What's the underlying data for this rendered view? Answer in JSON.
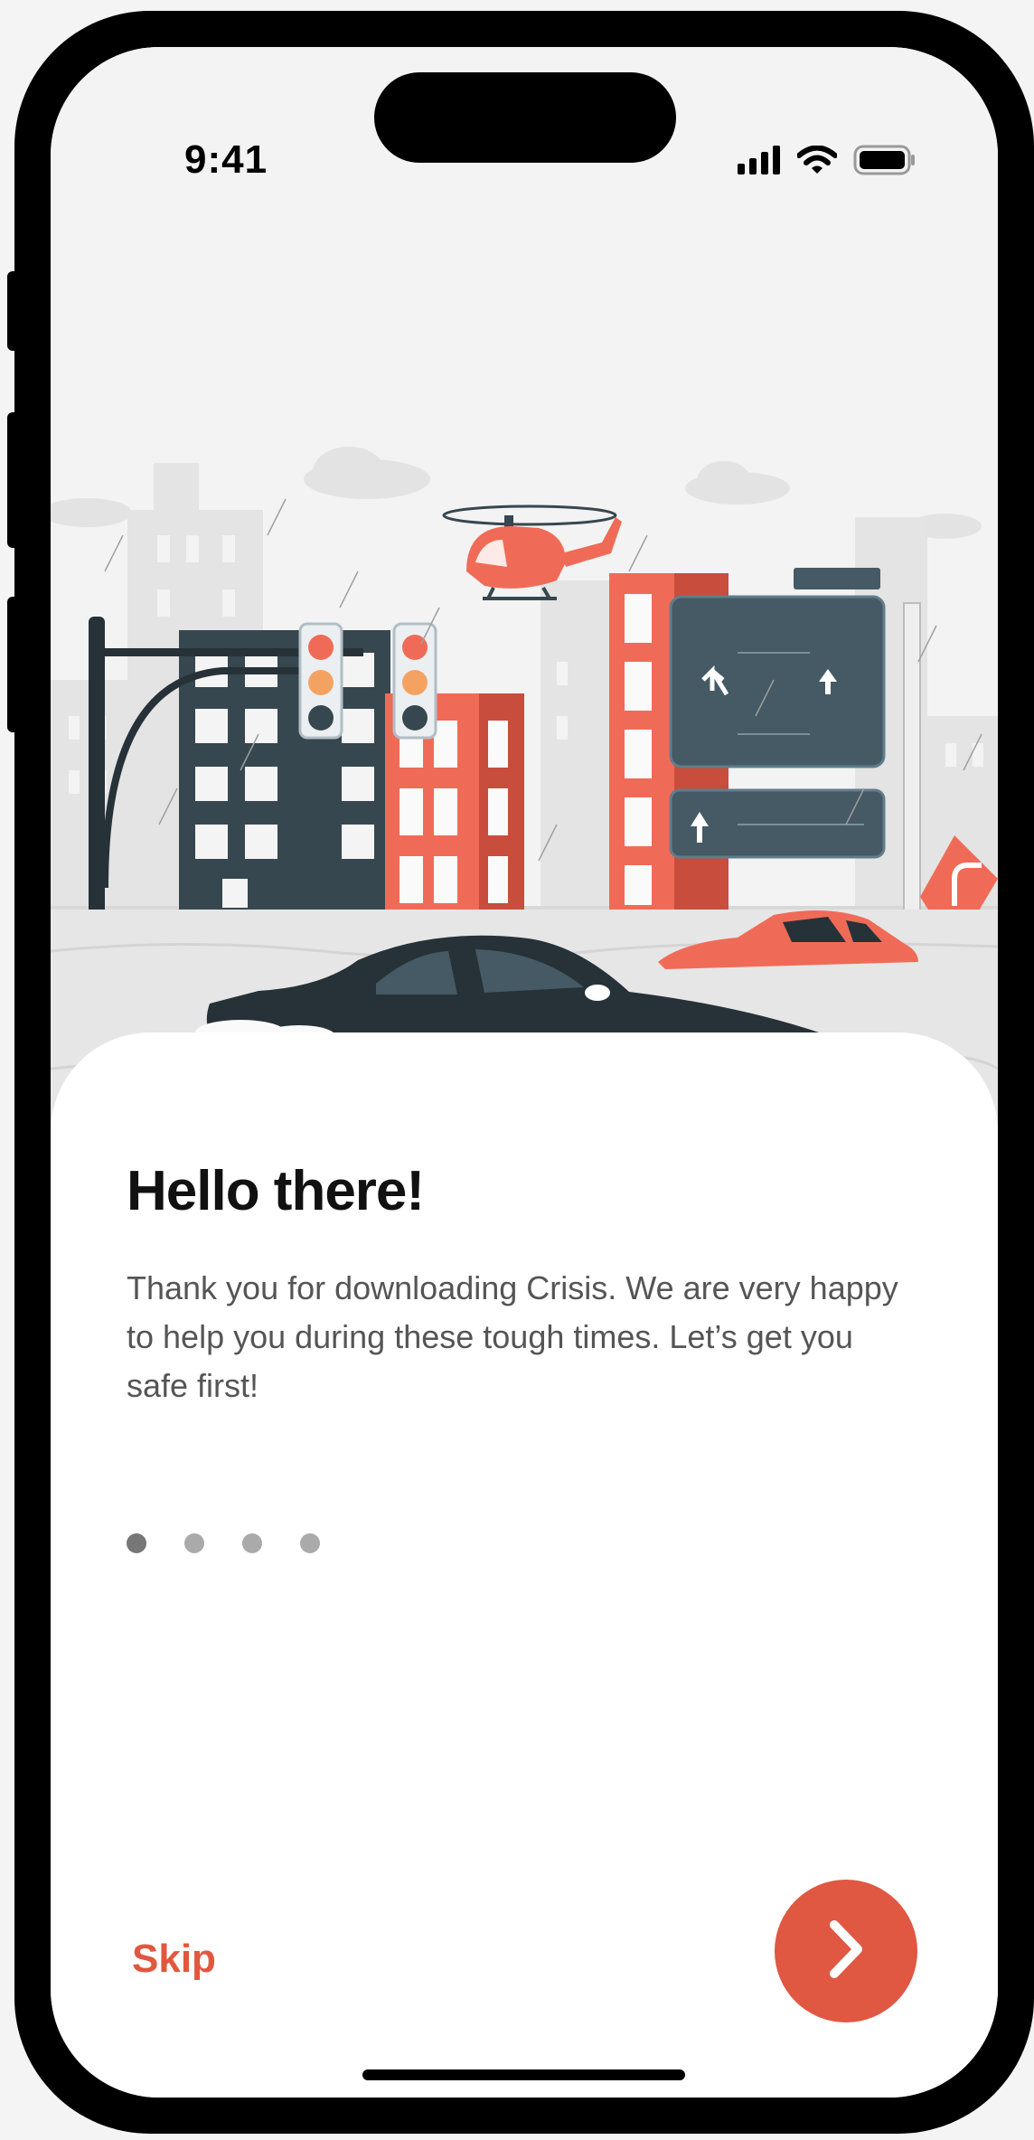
{
  "status_bar": {
    "time": "9:41",
    "icons": [
      "signal-icon",
      "wifi-icon",
      "battery-icon"
    ]
  },
  "hero": {
    "illustration": "flooded-city-illustration",
    "accent_color": "#f06b57",
    "dark_color": "#37474f"
  },
  "onboarding": {
    "title": "Hello there!",
    "body": "Thank you for downloading Crisis. We are very happy to help you during these tough times. Let’s get you safe first!",
    "page_indicator": {
      "current": 1,
      "total": 4
    },
    "skip_label": "Skip",
    "next_icon": "chevron-right-icon"
  },
  "colors": {
    "brand": "#e05742",
    "title": "#111111",
    "body": "#555555"
  }
}
